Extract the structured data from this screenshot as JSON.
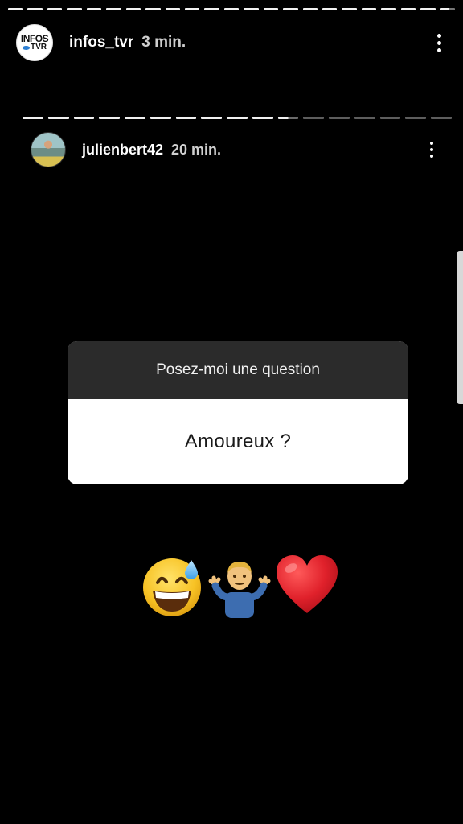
{
  "outer_story": {
    "username": "infos_tvr",
    "time_ago": "3 min.",
    "avatar_logo": {
      "top": "INFOS",
      "bottom": "TVR"
    },
    "progress_segments": 23
  },
  "inner_story": {
    "username": "julienbert42",
    "time_ago": "20 min.",
    "progress_segments": 17,
    "progress_completed_segments": 10
  },
  "question_sticker": {
    "prompt": "Posez-moi une question",
    "answer": "Amoureux ?"
  },
  "emojis": [
    "grinning-face-with-sweat-icon",
    "man-shrugging-icon",
    "red-heart-icon"
  ],
  "colors": {
    "background": "#000000",
    "sticker_header": "#2b2b2b",
    "sticker_body": "#ffffff",
    "heart": "#e0212b"
  }
}
